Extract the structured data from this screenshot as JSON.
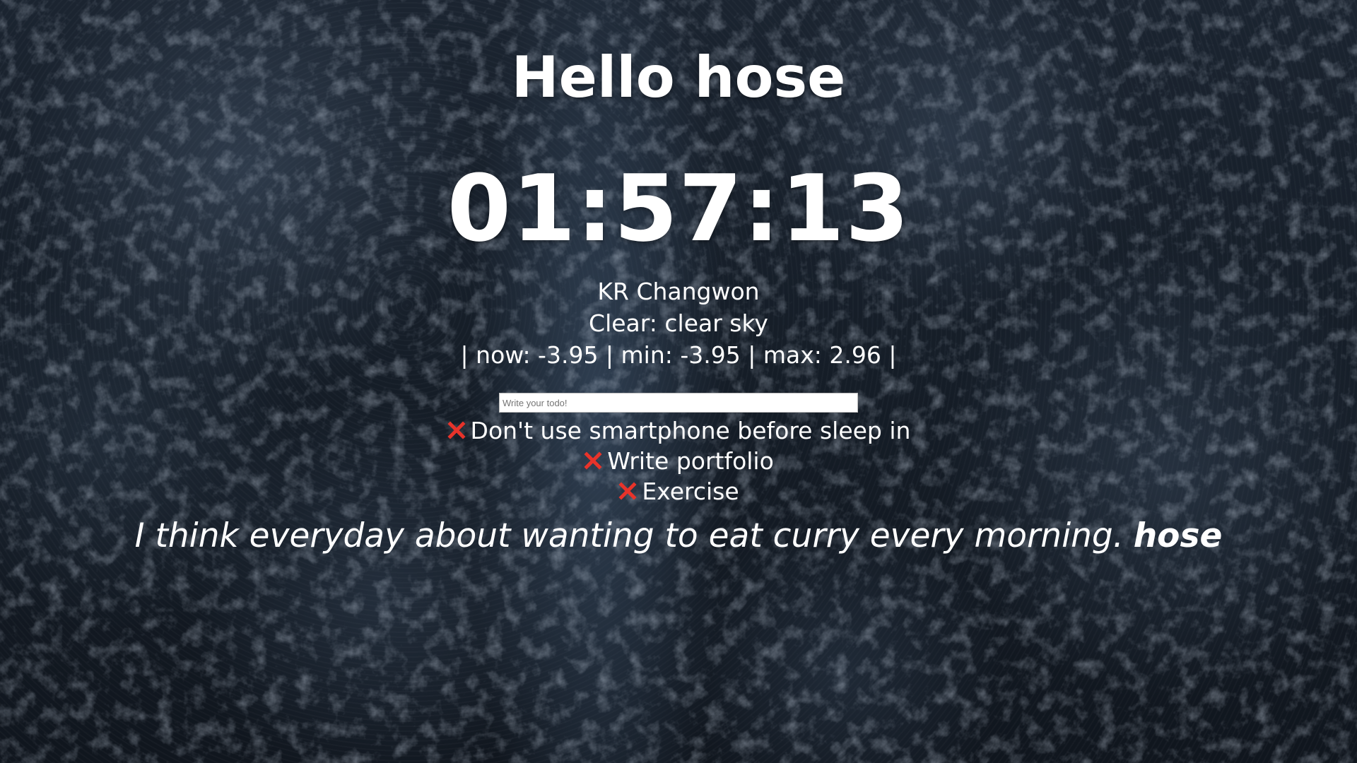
{
  "greeting": {
    "text": "Hello hose"
  },
  "clock": {
    "time": "01:57:13"
  },
  "weather": {
    "location": "KR Changwon",
    "condition": "Clear: clear sky",
    "temps": "| now: -3.95 | min: -3.95 | max: 2.96 |"
  },
  "todo": {
    "placeholder": "Write your todo!",
    "items": [
      {
        "label": "Don't use smartphone before sleep in",
        "delete_icon": "cross-mark-icon"
      },
      {
        "label": "Write portfolio",
        "delete_icon": "cross-mark-icon"
      },
      {
        "label": "Exercise",
        "delete_icon": "cross-mark-icon"
      }
    ]
  },
  "quote": {
    "text": "I think everyday about wanting to eat curry every morning.",
    "author": "hose"
  },
  "colors": {
    "text": "#ffffff",
    "delete_icon": "#e8332a",
    "background": "#151d27"
  }
}
